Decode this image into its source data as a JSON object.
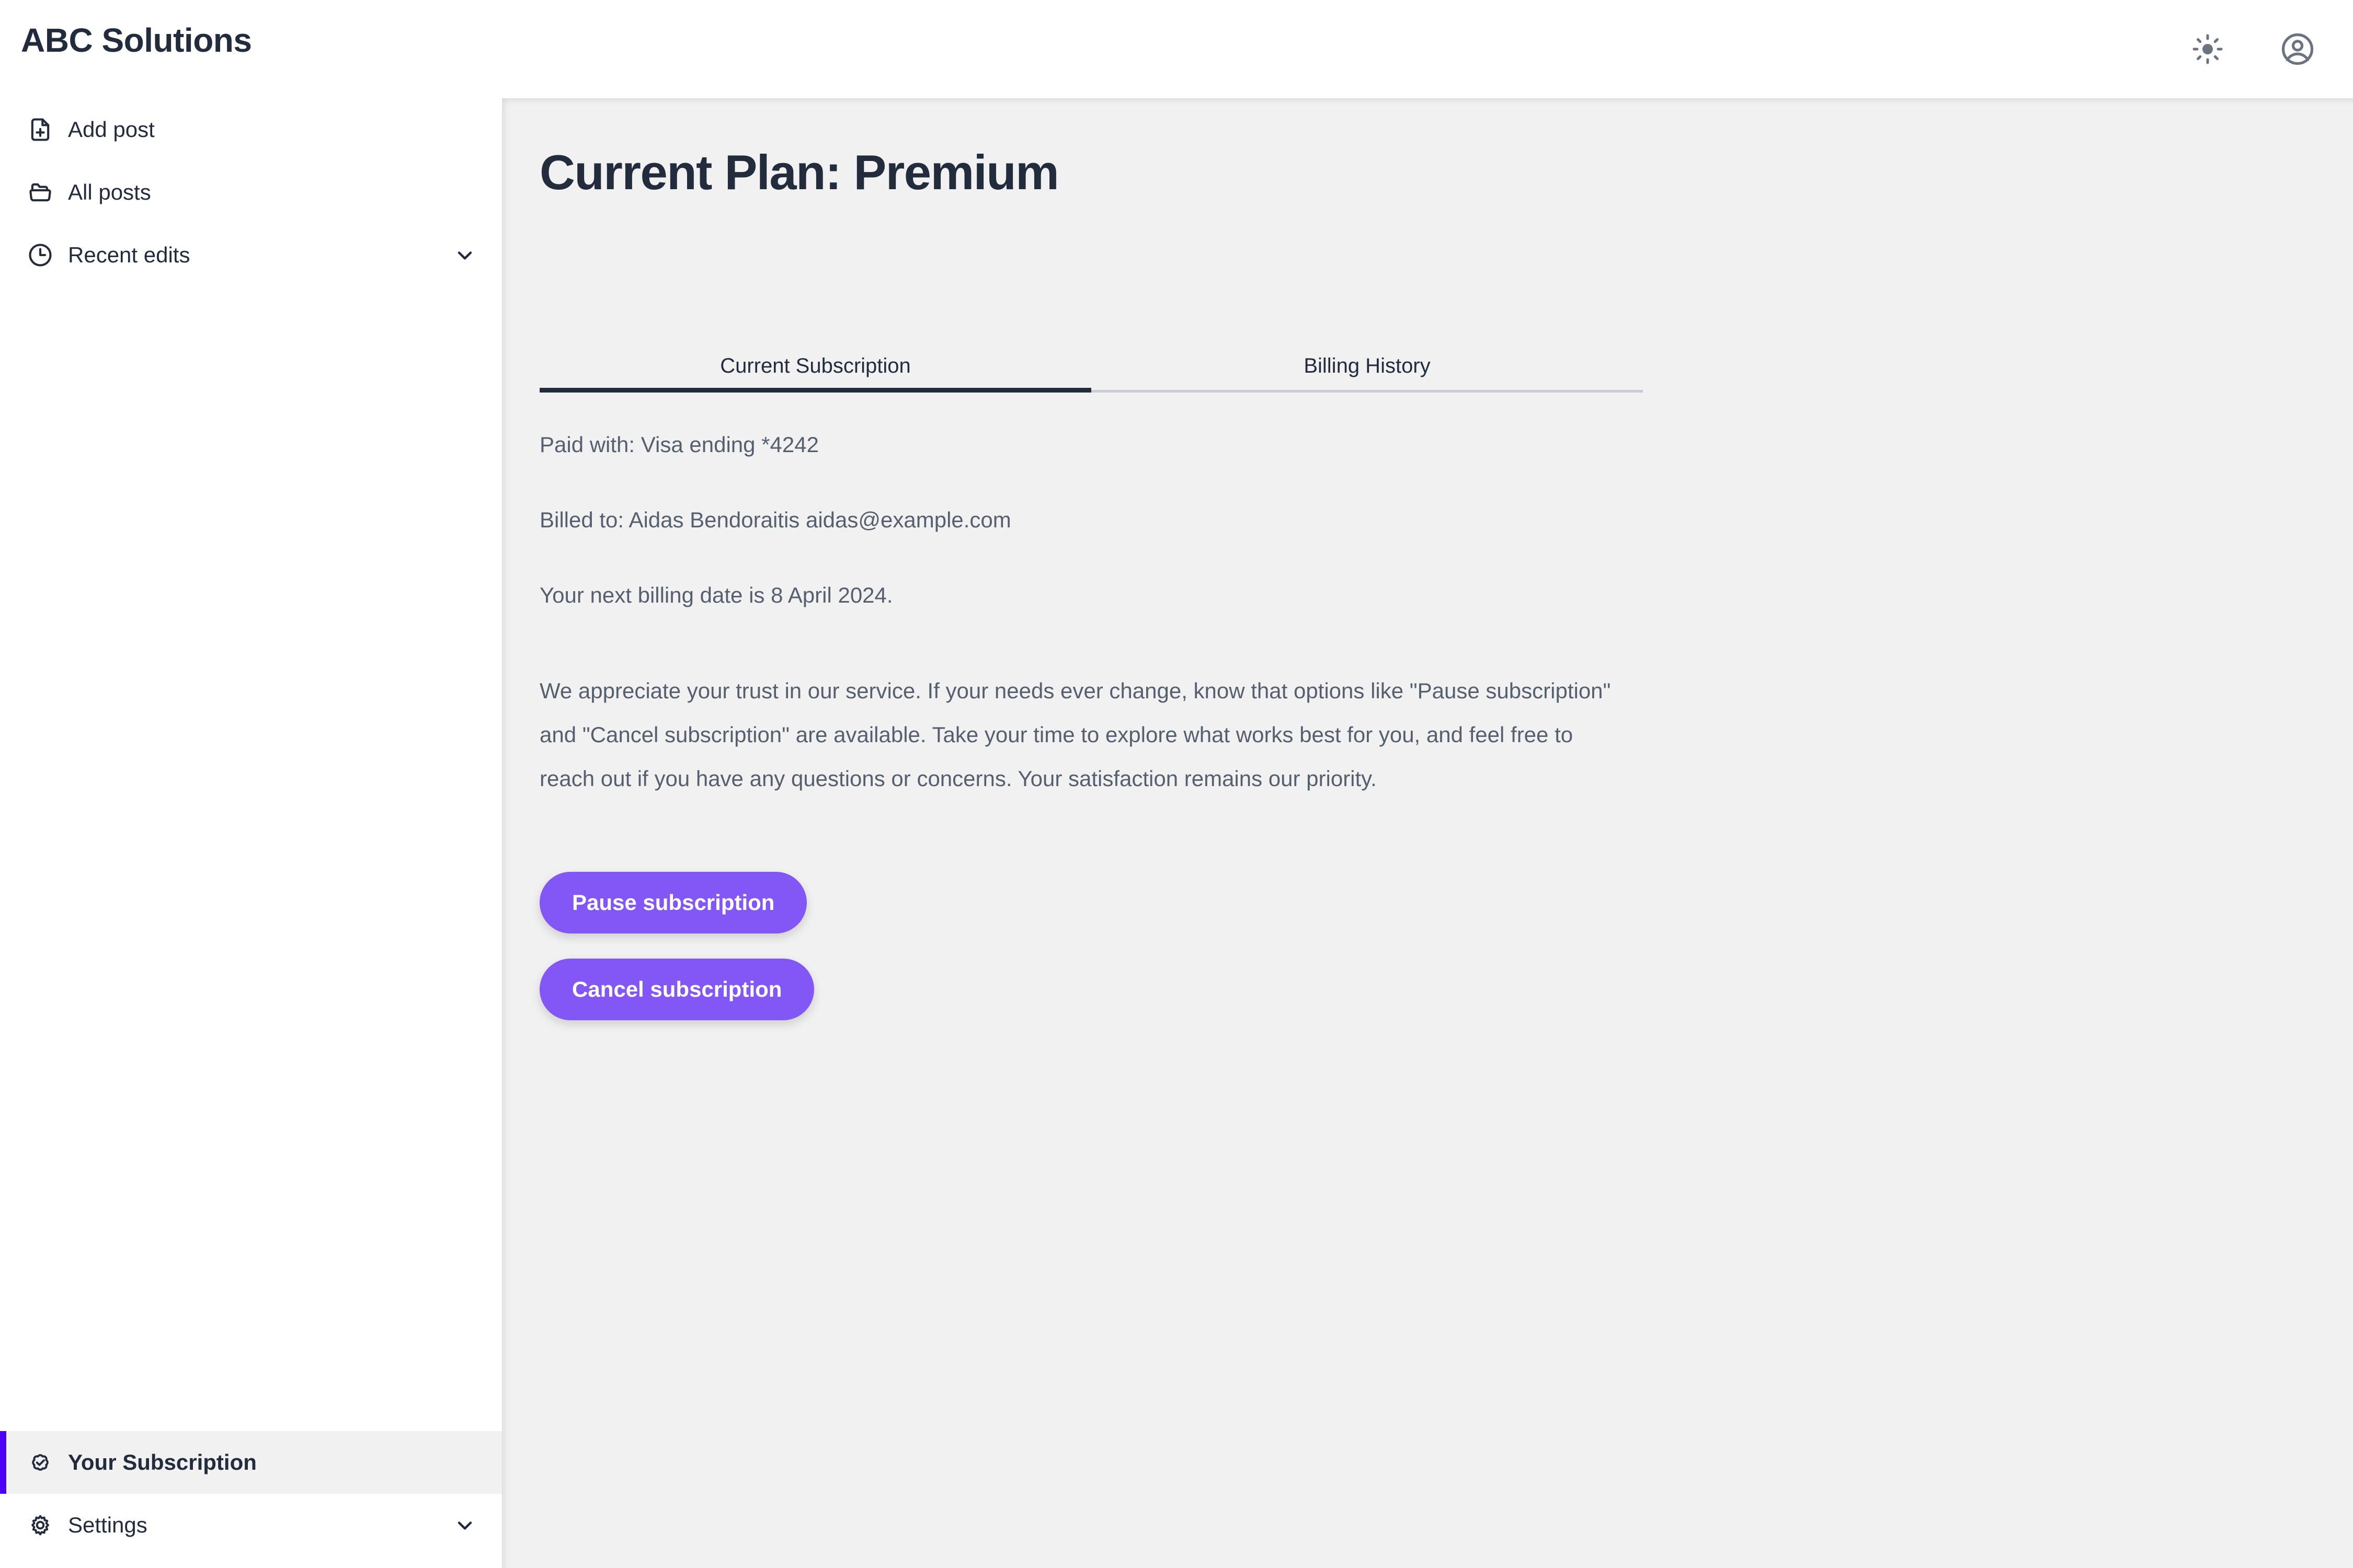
{
  "app": {
    "brand_title": "ABC Solutions"
  },
  "topbar": {
    "theme_toggle_icon": "sun-icon",
    "account_icon": "user-circle-icon"
  },
  "sidebar": {
    "top_items": [
      {
        "label": "Add post",
        "icon": "file-plus-icon",
        "has_chevron": false,
        "active": false
      },
      {
        "label": "All posts",
        "icon": "folder-icon",
        "has_chevron": false,
        "active": false
      },
      {
        "label": "Recent edits",
        "icon": "clock-icon",
        "has_chevron": true,
        "active": false
      }
    ],
    "bottom_items": [
      {
        "label": "Your Subscription",
        "icon": "badge-check-icon",
        "has_chevron": false,
        "active": true
      },
      {
        "label": "Settings",
        "icon": "gear-icon",
        "has_chevron": true,
        "active": false
      }
    ]
  },
  "main": {
    "page_title": "Current Plan: Premium",
    "tabs": [
      {
        "label": "Current Subscription",
        "active": true
      },
      {
        "label": "Billing History",
        "active": false
      }
    ],
    "details": {
      "paid_with": "Paid with: Visa ending *4242",
      "billed_to": "Billed to: Aidas Bendoraitis aidas@example.com",
      "next_billing": "Your next billing date is 8 April 2024."
    },
    "notice": "We appreciate your trust in our service. If your needs ever change, know that options like \"Pause subscription\" and \"Cancel subscription\" are available. Take your time to explore what works best for you, and feel free to reach out if you have any questions or concerns. Your satisfaction remains our priority.",
    "actions": {
      "pause_label": "Pause subscription",
      "cancel_label": "Cancel subscription"
    }
  },
  "colors": {
    "accent_purple": "#8257f5",
    "active_indicator": "#4d00f2",
    "text_dark": "#232c3d",
    "text_body": "#565f6e",
    "content_bg": "#f1f1f1",
    "sidebar_bg": "#ffffff",
    "tab_inactive_rule": "#c9ccd2"
  }
}
